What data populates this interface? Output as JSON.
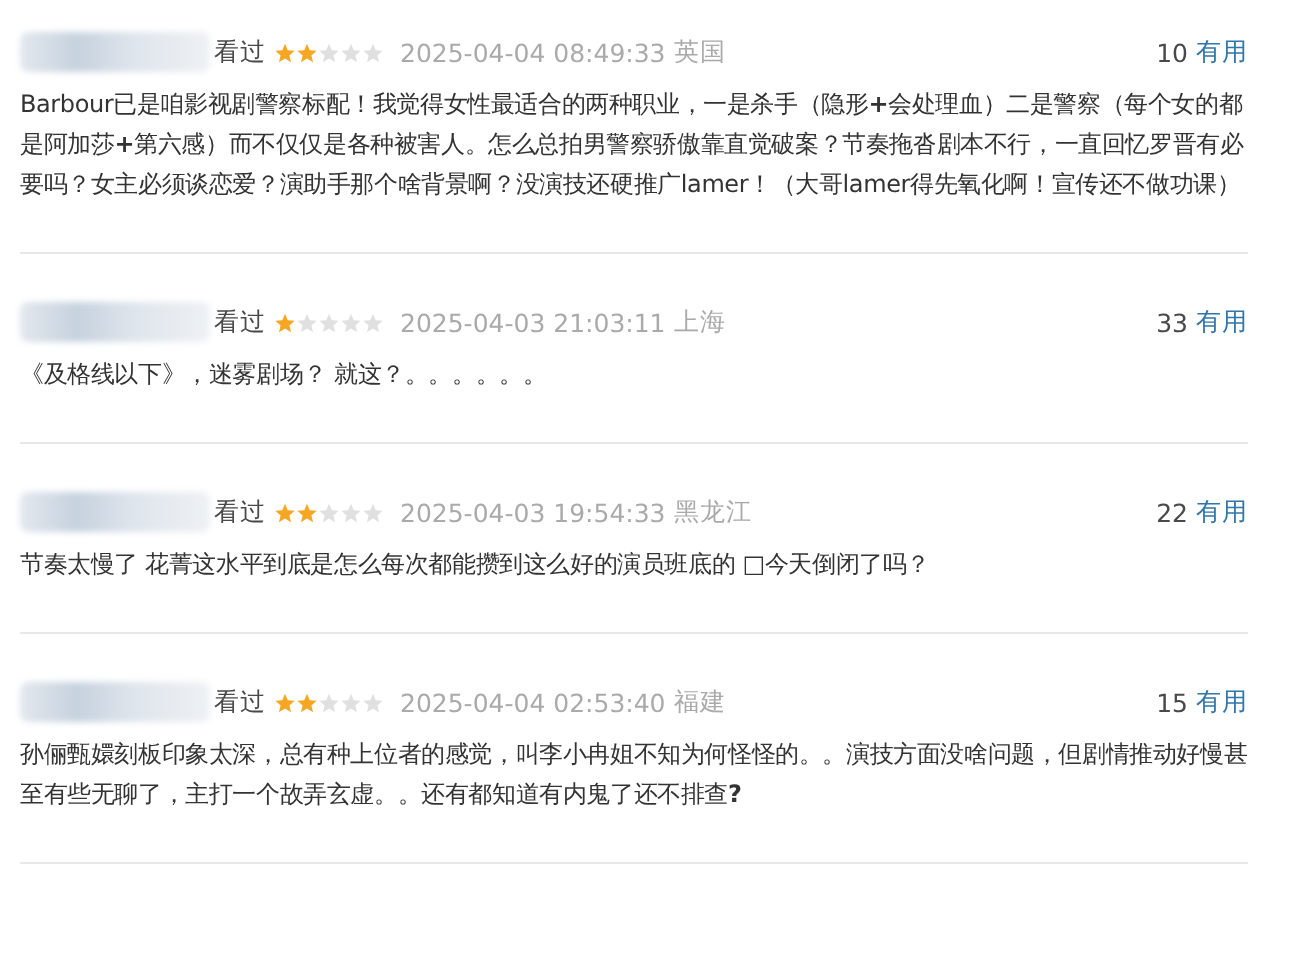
{
  "reviews": [
    {
      "status": "看过",
      "stars": 2,
      "time": "2025-04-04 08:49:33",
      "location": "英国",
      "votes": "10",
      "vote_label": "有用",
      "text": "Barbour已是咱影视剧警察标配！我觉得女性最适合的两种职业，一是杀手（隐形**+**会处理血）二是警察（每个女的都是阿加莎**+**第六感）而不仅仅是各种被害人。怎么总拍男警察骄傲靠直觉破案？节奏拖沓剧本不行，一直回忆罗晋有必要吗？女主必须谈恋爱？演助手那个啥背景啊？没演技还硬推广lamer！（大哥lamer得先氧化啊！宣传还不做功课）"
    },
    {
      "status": "看过",
      "stars": 1,
      "time": "2025-04-03 21:03:11",
      "location": "上海",
      "votes": "33",
      "vote_label": "有用",
      "text": "《及格线以下》，迷雾剧场？ 就这？。。。。。。"
    },
    {
      "status": "看过",
      "stars": 2,
      "time": "2025-04-03 19:54:33",
      "location": "黑龙江",
      "votes": "22",
      "vote_label": "有用",
      "text": "节奏太慢了 花菁这水平到底是怎么每次都能攒到这么好的演员班底的 □今天倒闭了吗？"
    },
    {
      "status": "看过",
      "stars": 2,
      "time": "2025-04-04 02:53:40",
      "location": "福建",
      "votes": "15",
      "vote_label": "有用",
      "text": "孙俪甄嬛刻板印象太深，总有种上位者的感觉，叫李小冉姐不知为何怪怪的。。演技方面没啥问题，但剧情推动好慢甚至有些无聊了，主打一个故弄玄虚。。还有都知道有内鬼了还不排查**?**"
    }
  ]
}
